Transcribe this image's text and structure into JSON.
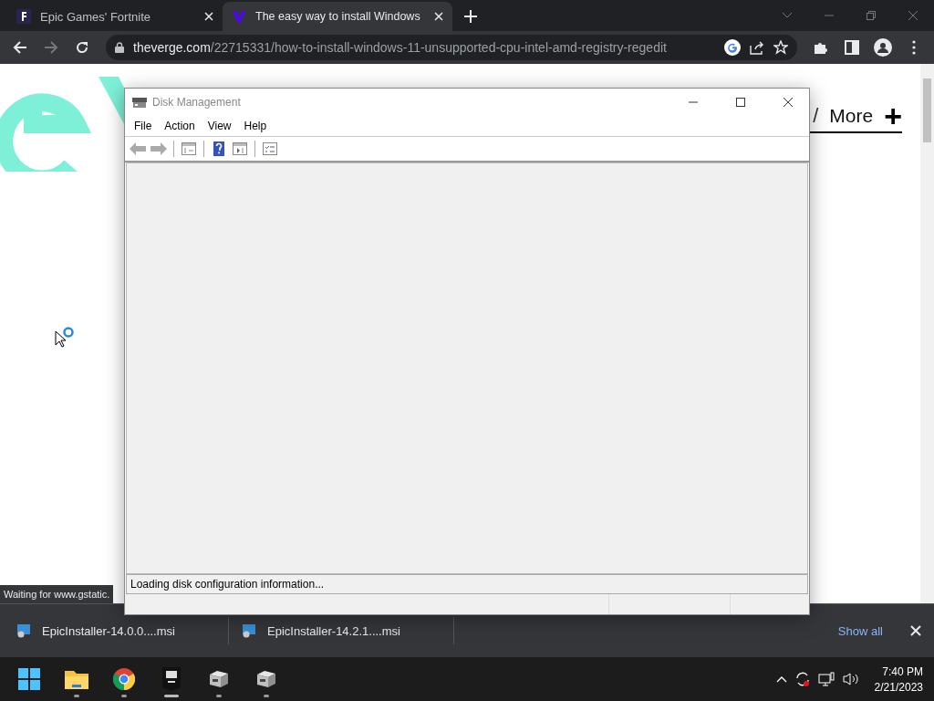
{
  "browser": {
    "tabs": [
      {
        "title": "Epic Games' Fortnite",
        "kind": "fortnite",
        "selected": false
      },
      {
        "title": "The easy way to install Windows",
        "kind": "verge",
        "selected": true
      }
    ],
    "address": {
      "domain": "theverge.com",
      "path": "/22715331/how-to-install-windows-11-unsupported-cpu-intel-amd-registry-regedit"
    },
    "page": {
      "nav_separator": "/",
      "nav_more": "More",
      "nav_plus": "+"
    },
    "status_text": "Waiting for www.gstatic."
  },
  "downloads": {
    "items": [
      {
        "name": "EpicInstaller-14.0.0....msi"
      },
      {
        "name": "EpicInstaller-14.2.1....msi"
      }
    ],
    "show_all": "Show all"
  },
  "dialog": {
    "title": "Disk Management",
    "menu": [
      "File",
      "Action",
      "View",
      "Help"
    ],
    "toolbar": [
      {
        "kind": "back"
      },
      {
        "kind": "forward"
      },
      {
        "kind": "sep"
      },
      {
        "kind": "console"
      },
      {
        "kind": "sep"
      },
      {
        "kind": "help"
      },
      {
        "kind": "pane"
      },
      {
        "kind": "sep"
      },
      {
        "kind": "list"
      }
    ],
    "status": "Loading disk configuration information..."
  },
  "taskbar": {
    "apps": [
      {
        "kind": "start",
        "running": false,
        "active": false
      },
      {
        "kind": "folder",
        "running": true,
        "active": false
      },
      {
        "kind": "chrome",
        "running": true,
        "active": false
      },
      {
        "kind": "epic",
        "running": true,
        "active": true
      },
      {
        "kind": "disk",
        "running": true,
        "active": false
      },
      {
        "kind": "disk",
        "running": true,
        "active": false
      }
    ],
    "time": "7:40 PM",
    "date": "2/21/2023"
  }
}
